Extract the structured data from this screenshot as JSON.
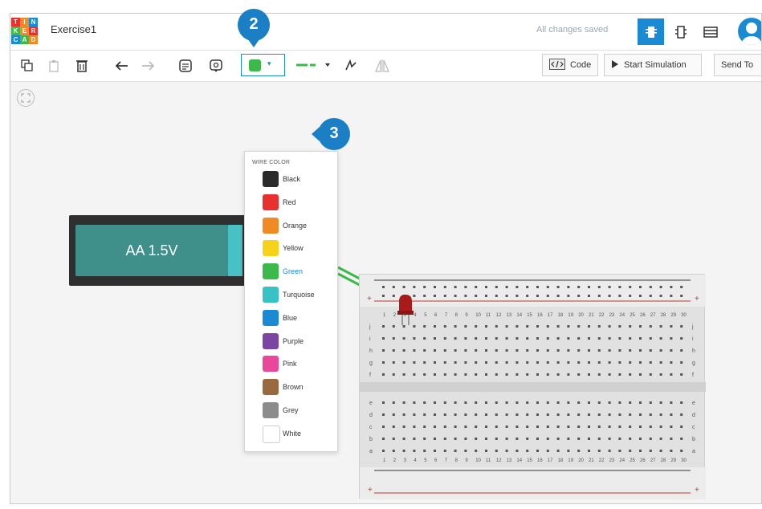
{
  "header": {
    "logo_letters": [
      "T",
      "I",
      "N",
      "K",
      "E",
      "R",
      "C",
      "A",
      "D"
    ],
    "title": "Exercise1",
    "status": "All changes saved"
  },
  "toolbar": {
    "icons": [
      "copy-icon",
      "paste-icon",
      "delete-icon",
      "undo-icon",
      "redo-icon",
      "notes-icon",
      "annotation-icon"
    ],
    "wire_color_selected": "#3db84a",
    "code_label": "Code",
    "start_simulation_label": "Start Simulation",
    "send_to_label": "Send To"
  },
  "battery": {
    "label": "AA 1.5V"
  },
  "wire_color_menu": {
    "heading": "WIRE COLOR",
    "selected": "Green",
    "colors": [
      {
        "name": "Black",
        "hex": "#2b2b2b"
      },
      {
        "name": "Red",
        "hex": "#e8302f"
      },
      {
        "name": "Orange",
        "hex": "#f08a24"
      },
      {
        "name": "Yellow",
        "hex": "#f7d21a"
      },
      {
        "name": "Green",
        "hex": "#3db84a"
      },
      {
        "name": "Turquoise",
        "hex": "#38c2c4"
      },
      {
        "name": "Blue",
        "hex": "#1a8ad4"
      },
      {
        "name": "Purple",
        "hex": "#7a45a3"
      },
      {
        "name": "Pink",
        "hex": "#e8479a"
      },
      {
        "name": "Brown",
        "hex": "#9a6a3f"
      },
      {
        "name": "Grey",
        "hex": "#8c8c8c"
      },
      {
        "name": "White",
        "hex": "#ffffff"
      }
    ]
  },
  "breadboard": {
    "column_numbers": [
      "1",
      "2",
      "3",
      "4",
      "5",
      "6",
      "7",
      "8",
      "9",
      "10",
      "11",
      "12",
      "13",
      "14",
      "15",
      "16",
      "17",
      "18",
      "19",
      "20",
      "21",
      "22",
      "23",
      "24",
      "25",
      "26",
      "27",
      "28",
      "29",
      "30"
    ],
    "rows_top": [
      "j",
      "i",
      "h",
      "g",
      "f"
    ],
    "rows_bottom": [
      "e",
      "d",
      "c",
      "b",
      "a"
    ],
    "rail_plus": "+",
    "rail_minus": "-"
  },
  "markers": [
    {
      "number": "2"
    },
    {
      "number": "3"
    }
  ],
  "colors": {
    "accent": "#1a8ad4",
    "marker": "#1a7fc4"
  }
}
